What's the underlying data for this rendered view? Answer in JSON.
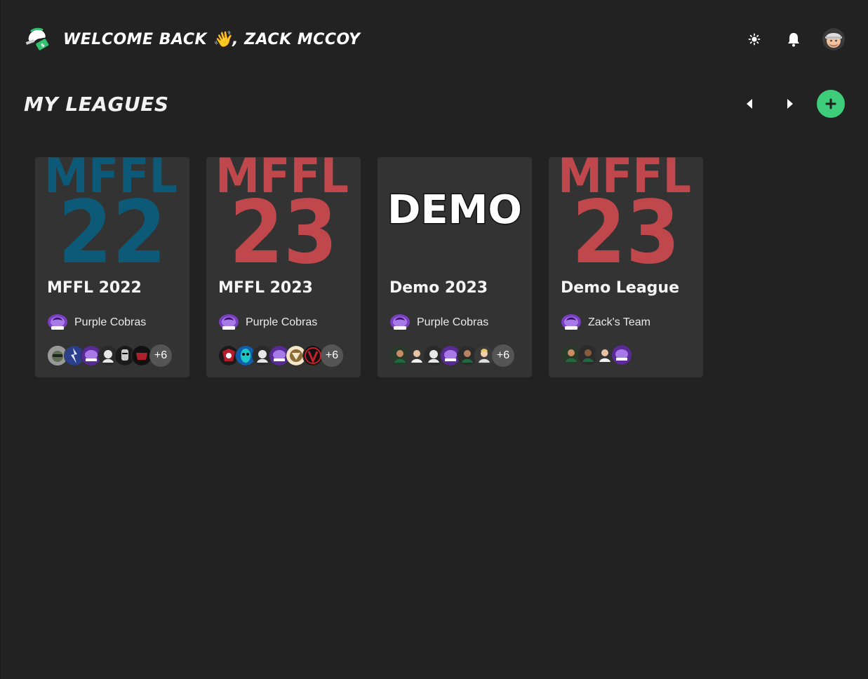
{
  "header": {
    "welcome_text": "Welcome Back 👋, Zack McCoy",
    "theme_toggle_icon": "sun-icon",
    "notifications_icon": "bell-icon",
    "avatar_icon": "user-avatar"
  },
  "leagues_section": {
    "title": "My Leagues",
    "prev_icon": "caret-left-icon",
    "next_icon": "caret-right-icon",
    "add_icon": "plus-icon",
    "add_color": "#3dcc7a"
  },
  "leagues": [
    {
      "art_line1": "MFFL",
      "art_line2": "22",
      "art_color": "#0d5a78",
      "name": "MFFL 2022",
      "team": "Purple Cobras",
      "more_count": "+6"
    },
    {
      "art_line1": "MFFL",
      "art_line2": "23",
      "art_color": "#c0474b",
      "name": "MFFL 2023",
      "team": "Purple Cobras",
      "more_count": "+6"
    },
    {
      "art_text": "DEMO",
      "name": "Demo 2023",
      "team": "Purple Cobras",
      "more_count": "+6"
    },
    {
      "art_line1": "MFFL",
      "art_line2": "23",
      "art_color": "#c0474b",
      "name": "Demo League",
      "team": "Zack's Team",
      "more_count": ""
    }
  ]
}
